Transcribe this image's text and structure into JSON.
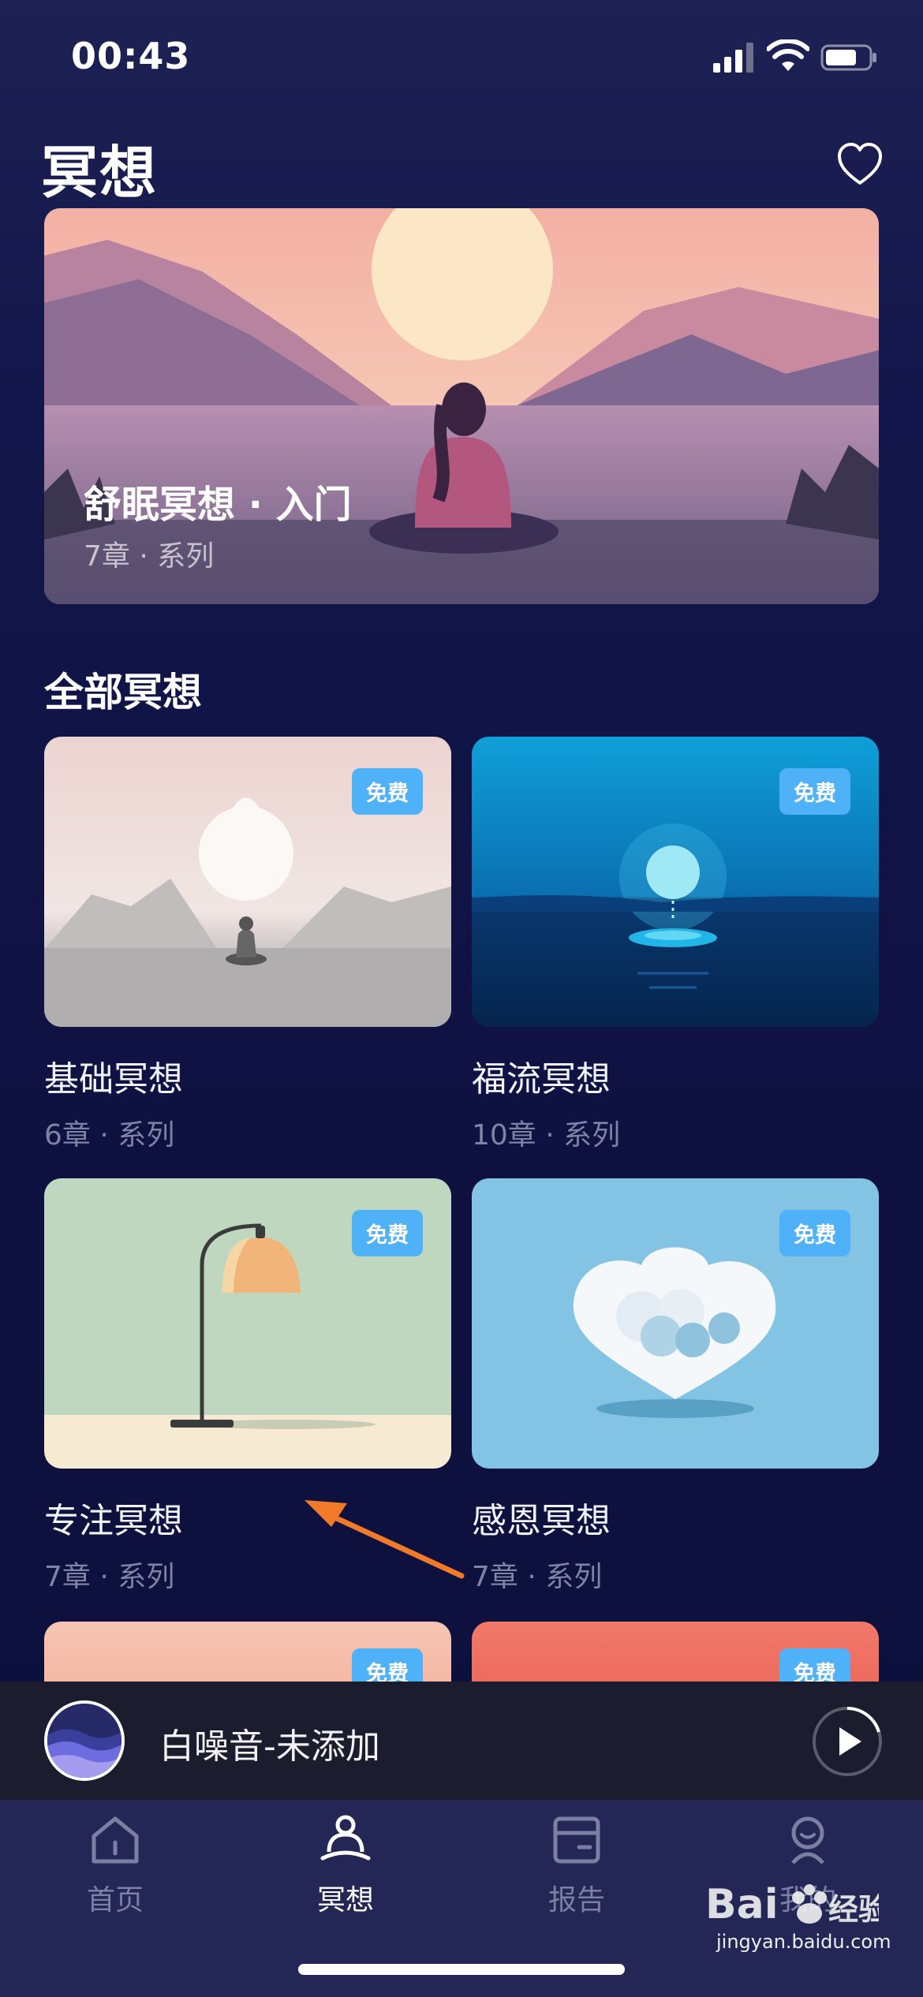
{
  "status": {
    "time": "00:43"
  },
  "header": {
    "title": "冥想"
  },
  "hero": {
    "title": "舒眠冥想 · 入门",
    "meta": "7章 · 系列"
  },
  "section": {
    "title": "全部冥想"
  },
  "cards": [
    {
      "title": "基础冥想",
      "meta": "6章 · 系列",
      "badge": "免费"
    },
    {
      "title": "福流冥想",
      "meta": "10章 · 系列",
      "badge": "免费"
    },
    {
      "title": "专注冥想",
      "meta": "7章 · 系列",
      "badge": "免费"
    },
    {
      "title": "感恩冥想",
      "meta": "7章 · 系列",
      "badge": "免费"
    },
    {
      "badge": "免费"
    },
    {
      "badge": "免费"
    }
  ],
  "player": {
    "title": "白噪音-未添加"
  },
  "tabs": [
    {
      "label": "首页"
    },
    {
      "label": "冥想"
    },
    {
      "label": "报告"
    },
    {
      "label": "我的"
    }
  ],
  "watermark": {
    "brand": "Bai du 经验",
    "url": "jingyan.baidu.com"
  },
  "colors": {
    "accent": "#4fb1f7",
    "annotation_arrow": "#f07a2a",
    "tab_active": "#ffffff",
    "tab_inactive": "#7c7fa4"
  }
}
